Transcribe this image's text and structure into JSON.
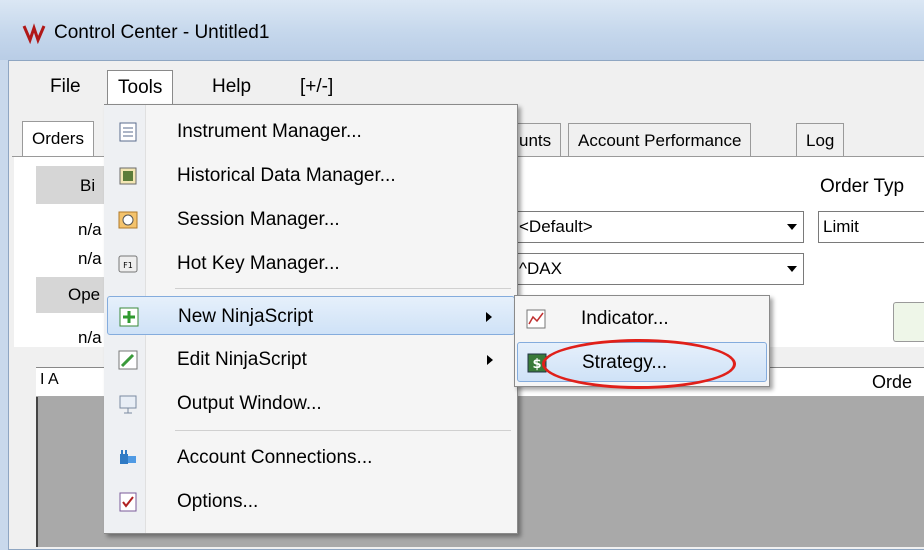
{
  "window": {
    "title": "Control Center - Untitled1"
  },
  "menubar": {
    "items": [
      "File",
      "Tools",
      "Help",
      "[+/-]"
    ]
  },
  "tabs": [
    "Orders",
    "unts",
    "Account Performance",
    "Log"
  ],
  "order_panel": {
    "bid_label": "Bi",
    "bid_values": [
      "n/a",
      "n/a"
    ],
    "open_label": "Ope",
    "open_value": "n/a",
    "account_combo": "<Default>",
    "instrument_combo": "^DAX",
    "order_type_label": "Order Typ",
    "order_type_combo": "Limit"
  },
  "grid": {
    "col_left": "I A",
    "col_right": "Orde"
  },
  "tools_menu": {
    "items": [
      {
        "label": "Instrument Manager...",
        "icon": "instrument-icon"
      },
      {
        "label": "Historical Data Manager...",
        "icon": "historical-data-icon"
      },
      {
        "label": "Session Manager...",
        "icon": "session-icon"
      },
      {
        "label": "Hot Key Manager...",
        "icon": "f1-key-icon"
      },
      {
        "label": "New NinjaScript",
        "icon": "plus-icon",
        "submenu": true,
        "highlighted": true
      },
      {
        "label": "Edit NinjaScript",
        "icon": "pencil-icon",
        "submenu": true
      },
      {
        "label": "Output Window...",
        "icon": "output-window-icon"
      },
      {
        "label": "Account Connections...",
        "icon": "plug-icon"
      },
      {
        "label": "Options...",
        "icon": "options-icon"
      }
    ]
  },
  "submenu": {
    "items": [
      {
        "label": "Indicator...",
        "icon": "indicator-chart-icon"
      },
      {
        "label": "Strategy...",
        "icon": "strategy-dollar-icon",
        "highlighted": true
      }
    ]
  },
  "colors": {
    "highlight_ring": "#e0201a",
    "menu_hover": "#cfe2f7"
  }
}
